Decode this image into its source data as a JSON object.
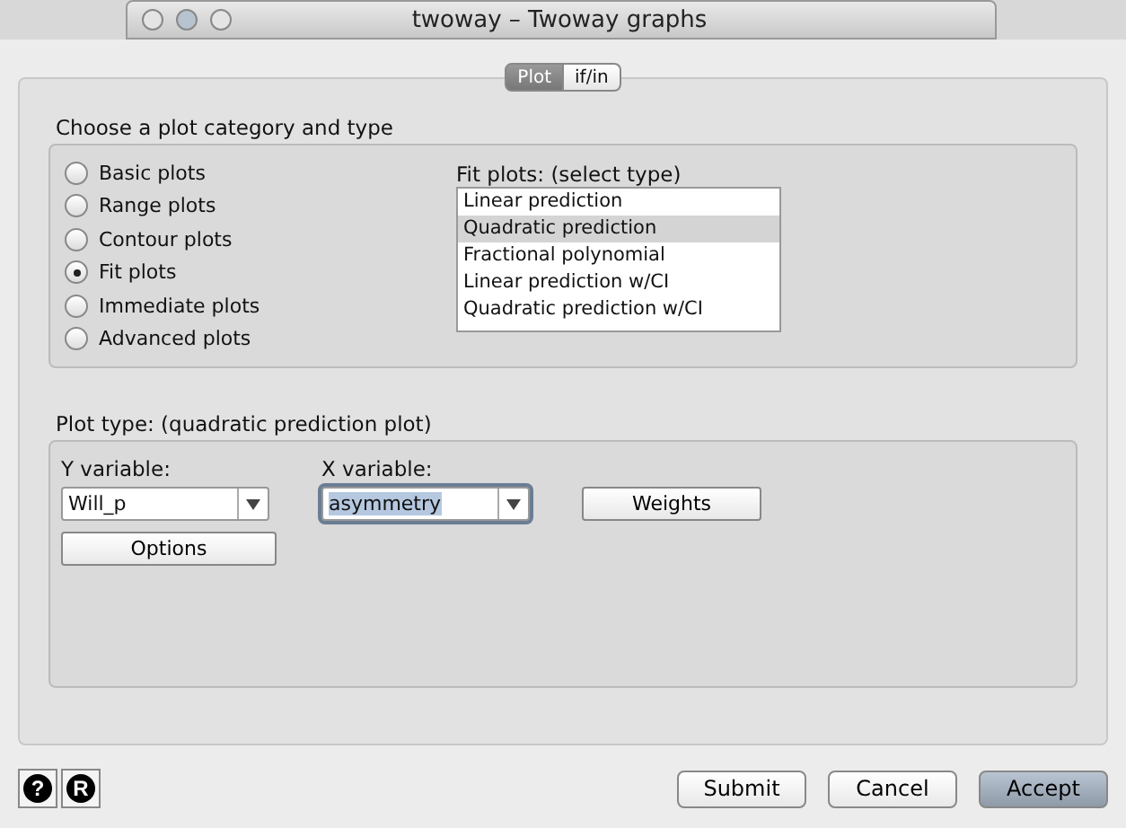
{
  "window": {
    "title": "twoway – Twoway graphs"
  },
  "tabs": [
    {
      "label": "Plot",
      "selected": true
    },
    {
      "label": "if/in",
      "selected": false
    }
  ],
  "category_group": {
    "label": "Choose a plot category and type",
    "categories": [
      {
        "label": "Basic plots",
        "selected": false
      },
      {
        "label": "Range plots",
        "selected": false
      },
      {
        "label": "Contour plots",
        "selected": false
      },
      {
        "label": "Fit plots",
        "selected": true
      },
      {
        "label": "Immediate plots",
        "selected": false
      },
      {
        "label": "Advanced plots",
        "selected": false
      }
    ],
    "type_list": {
      "label": "Fit plots: (select type)",
      "items": [
        {
          "label": "Linear prediction",
          "selected": false
        },
        {
          "label": "Quadratic prediction",
          "selected": true
        },
        {
          "label": "Fractional polynomial",
          "selected": false
        },
        {
          "label": "Linear prediction w/CI",
          "selected": false
        },
        {
          "label": "Quadratic prediction w/CI",
          "selected": false
        }
      ]
    }
  },
  "plot_type_group": {
    "label": "Plot type: (quadratic prediction plot)",
    "y_variable": {
      "label": "Y variable:",
      "value": "Will_p",
      "focused": false
    },
    "x_variable": {
      "label": "X variable:",
      "value": "asymmetry",
      "focused": true
    },
    "weights_button": "Weights",
    "options_button": "Options"
  },
  "help_buttons": [
    "?",
    "R"
  ],
  "buttons": [
    {
      "label": "Submit",
      "default": false
    },
    {
      "label": "Cancel",
      "default": false
    },
    {
      "label": "Accept",
      "default": true
    }
  ]
}
